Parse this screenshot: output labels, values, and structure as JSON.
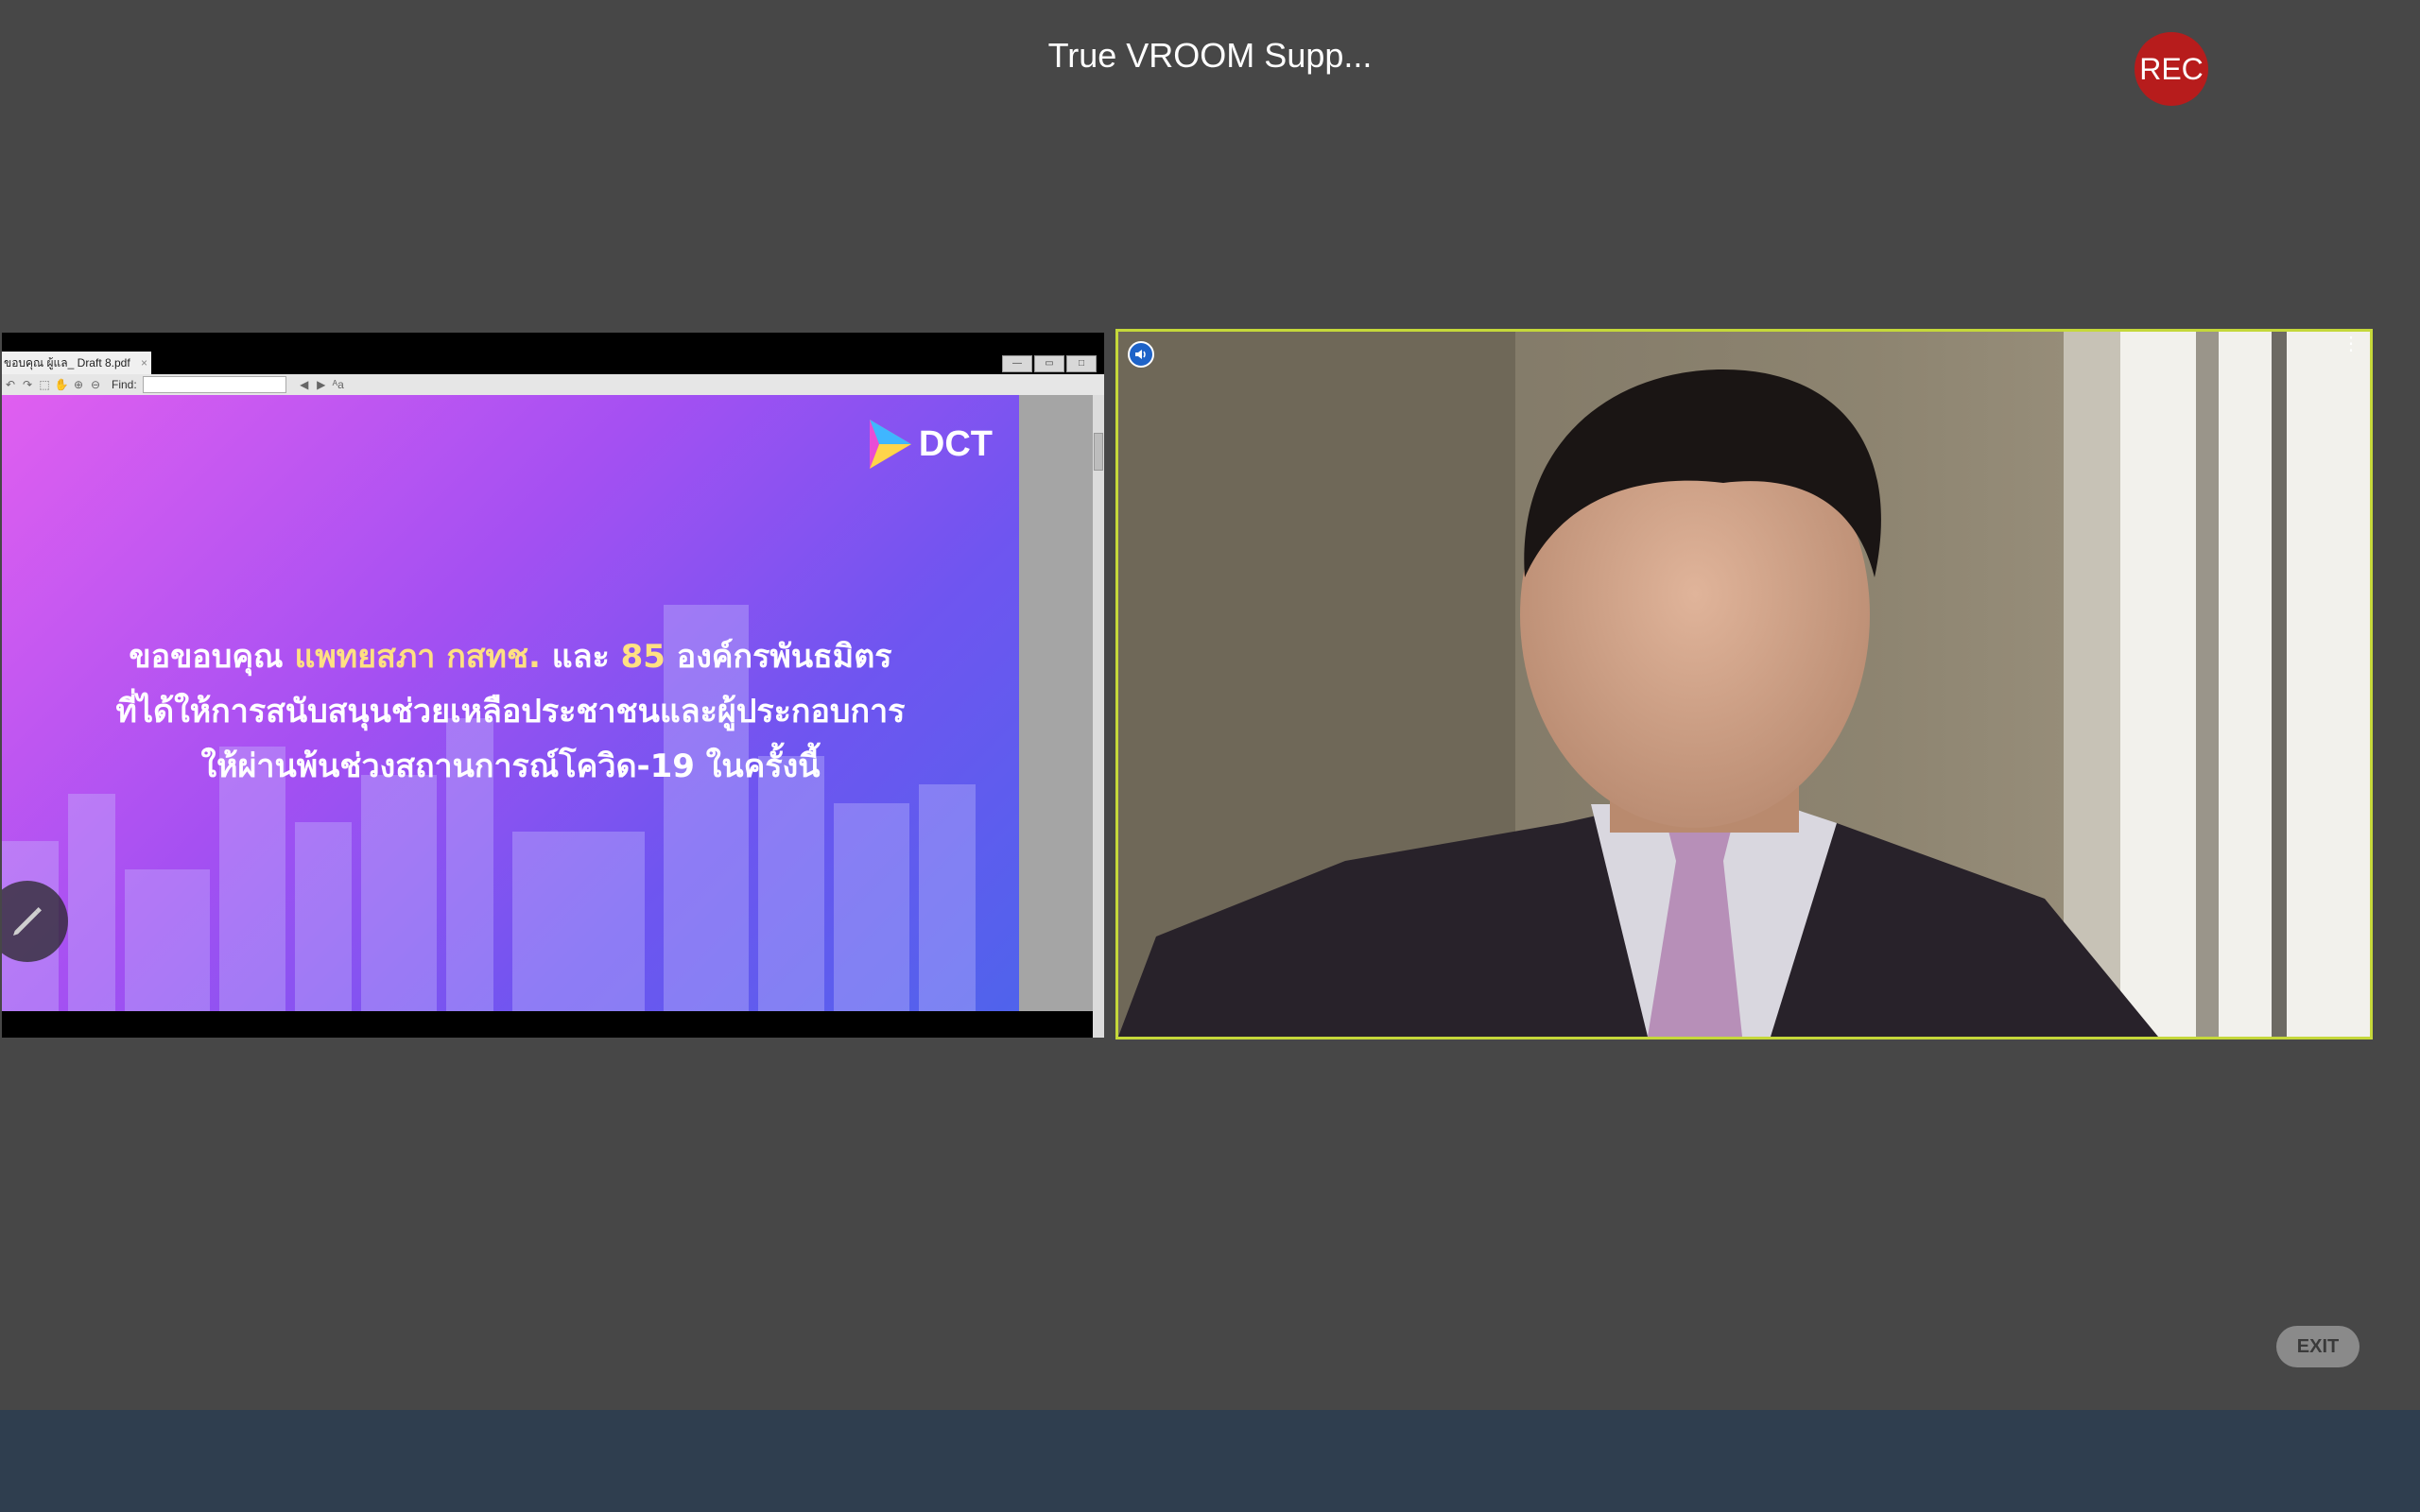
{
  "meeting": {
    "title": "True VROOM Supp...",
    "rec_label": "REC"
  },
  "share": {
    "tab_label": "ขอบคุณ ผู้แล_ Draft 8.pdf",
    "tab_close": "×",
    "find_label": "Find:",
    "slide": {
      "logo": "DCT",
      "line1": {
        "a": "ขอขอบคุณ ",
        "b": "แพทยสภา กสทช.",
        "c": " และ ",
        "d": "85",
        "e": " องค์กรพันธมิตร"
      },
      "line2": "ที่ได้ให้การสนับสนุนช่วยเหลือประชาชนและผู้ประกอบการ",
      "line3": "ให้ผ่านพ้นช่วงสถานการณ์โควิด-19 ในครั้งนี้"
    }
  },
  "controls": {
    "exit_label": "EXIT",
    "tile_menu": "⋮"
  },
  "colors": {
    "background": "#474747",
    "active_speaker_border": "#c5d83a",
    "rec": "#b71c1c",
    "bottom_bar": "#2f3e4f",
    "slide_highlight": "#ffe082"
  },
  "icons": {
    "annotate": "pencil-icon",
    "speaker": "speaker-icon",
    "tile_menu": "more-vertical-icon"
  }
}
